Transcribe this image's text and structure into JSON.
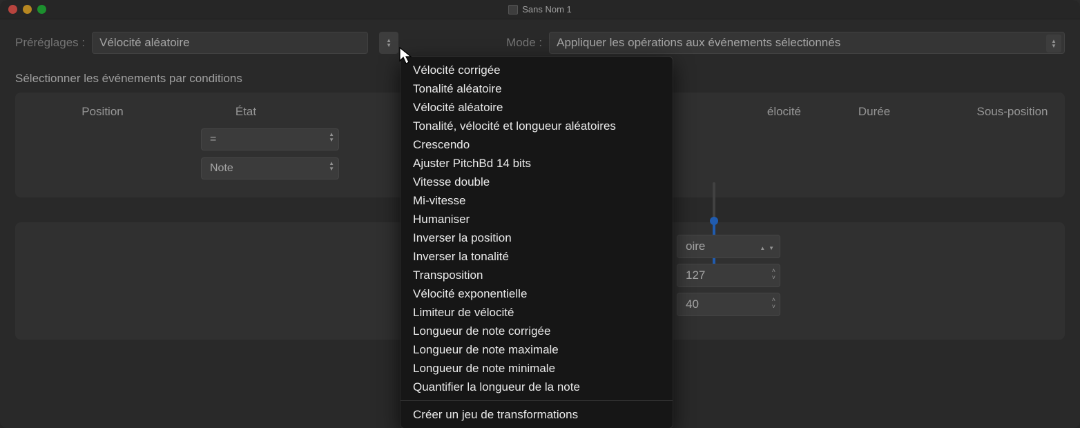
{
  "window": {
    "title": "Sans Nom 1"
  },
  "toprow": {
    "presets_label": "Préréglages :",
    "presets_value": "Vélocité aléatoire",
    "mode_label": "Mode :",
    "mode_value": "Appliquer les opérations aux événements sélectionnés"
  },
  "section1": {
    "title": "Sélectionner les événements par conditions"
  },
  "columns": {
    "c1": "Position",
    "c2": "État",
    "c5_partial": "élocité",
    "c6": "Durée",
    "c7": "Sous-position"
  },
  "etat": {
    "operator": "=",
    "value": "Note"
  },
  "vel_panel": {
    "select_partial": "oire",
    "num1": "127",
    "num2": "40"
  },
  "popup": {
    "items": [
      "Vélocité corrigée",
      "Tonalité aléatoire",
      "Vélocité aléatoire",
      "Tonalité, vélocité et longueur aléatoires",
      "Crescendo",
      "Ajuster PitchBd 14 bits",
      "Vitesse double",
      "Mi-vitesse",
      "Humaniser",
      "Inverser la position",
      "Inverser la tonalité",
      "Transposition",
      "Vélocité exponentielle",
      "Limiteur de vélocité",
      "Longueur de note corrigée",
      "Longueur de note maximale",
      "Longueur de note minimale",
      "Quantifier la longueur de la note"
    ],
    "footer": "Créer un jeu de transformations"
  }
}
